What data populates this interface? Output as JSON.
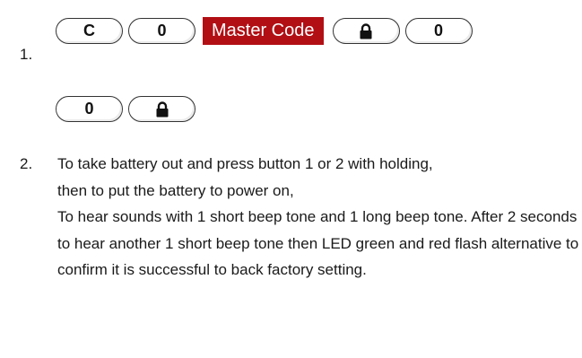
{
  "step1": {
    "number": "1.",
    "row1": [
      {
        "type": "key",
        "label": "C"
      },
      {
        "type": "key",
        "label": "0"
      },
      {
        "type": "code",
        "label": "Master Code"
      },
      {
        "type": "icon",
        "icon": "lock-icon"
      },
      {
        "type": "key",
        "label": "0"
      }
    ],
    "row2": [
      {
        "type": "key",
        "label": "0"
      },
      {
        "type": "icon",
        "icon": "lock-icon"
      }
    ]
  },
  "step2": {
    "number": "2.",
    "line1": "To take battery out and press button 1 or 2 with holding,",
    "line2": "then to put the battery to power on,",
    "paragraph2": "To hear sounds with 1 short beep tone and 1 long beep tone. After 2 seconds to hear another 1 short beep tone then LED green and red flash alternative to confirm it is successful to back factory setting."
  },
  "colors": {
    "master_code_bg": "#b10f14",
    "master_code_text": "#ffffff",
    "key_border": "#333333"
  }
}
